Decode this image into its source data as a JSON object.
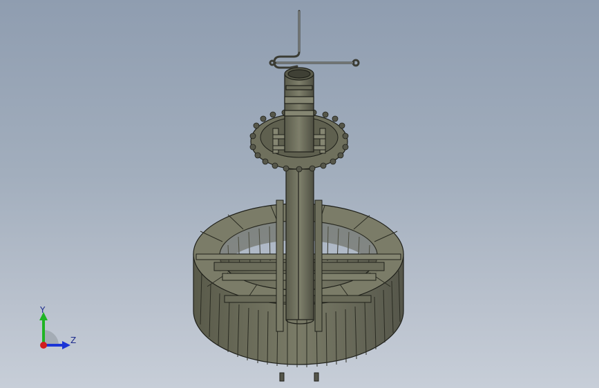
{
  "viewport": {
    "model": "water-turbine-runner-assembly",
    "colors": {
      "background_top": "#8f9db0",
      "background_bottom": "#c7ced8",
      "metal": "#6e6f5e",
      "metal_light": "#8b8c78",
      "metal_dark": "#4a4b3e",
      "edge": "#1e1f19"
    }
  },
  "triad": {
    "y_label": "Y",
    "z_label": "Z",
    "y_color": "#1fb424",
    "z_color": "#1b35d6",
    "x_color": "#d11d1d"
  }
}
